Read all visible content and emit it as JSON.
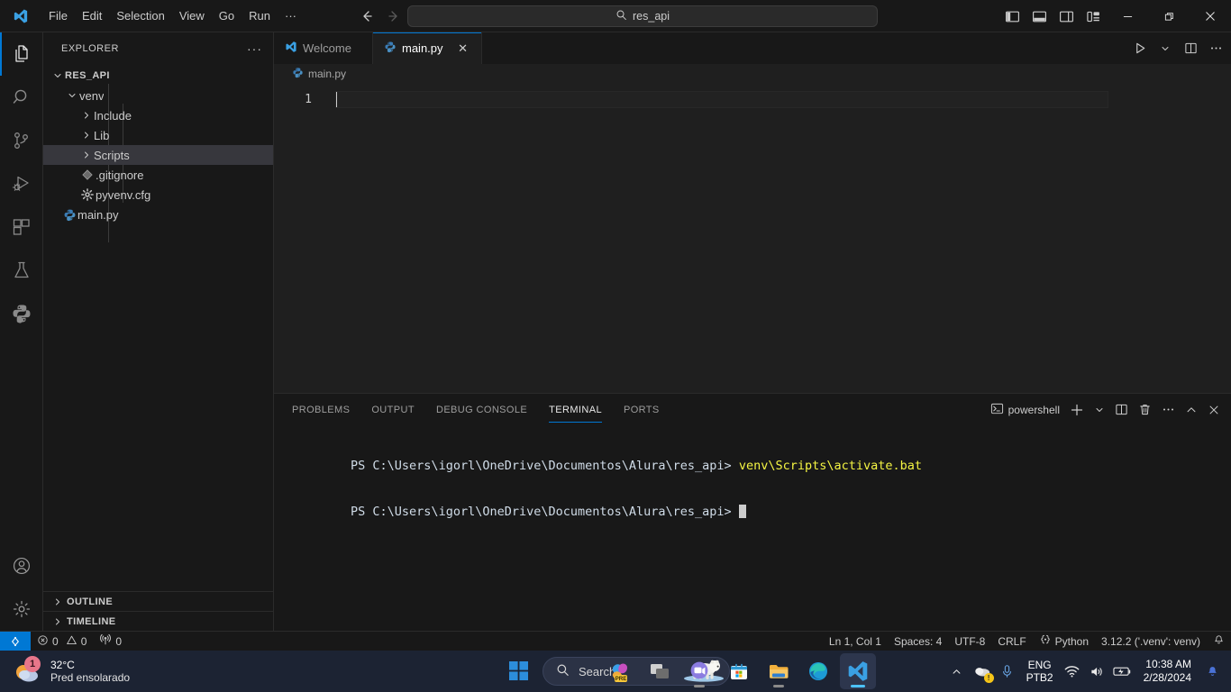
{
  "titlebar": {
    "menu": [
      "File",
      "Edit",
      "Selection",
      "View",
      "Go",
      "Run",
      "···"
    ],
    "command_center_value": "res_api",
    "back_icon": "arrow-left-icon",
    "forward_icon": "arrow-right-icon",
    "layout_icons": [
      "toggle-primary-sidebar-icon",
      "toggle-panel-icon",
      "toggle-secondary-sidebar-icon",
      "customize-layout-icon"
    ],
    "window_controls": [
      "minimize",
      "restore",
      "close"
    ]
  },
  "activitybar": {
    "items": [
      {
        "name": "explorer",
        "icon": "files-icon",
        "active": true
      },
      {
        "name": "search",
        "icon": "search-icon",
        "active": false
      },
      {
        "name": "source-control",
        "icon": "source-control-icon",
        "active": false
      },
      {
        "name": "run-and-debug",
        "icon": "run-debug-icon",
        "active": false
      },
      {
        "name": "extensions",
        "icon": "extensions-icon",
        "active": false
      },
      {
        "name": "testing",
        "icon": "beaker-icon",
        "active": false
      },
      {
        "name": "python",
        "icon": "python-icon",
        "active": false
      }
    ],
    "bottom": [
      {
        "name": "accounts",
        "icon": "account-icon"
      },
      {
        "name": "manage",
        "icon": "gear-icon"
      }
    ]
  },
  "sidebar": {
    "title": "EXPLORER",
    "more_actions": "···",
    "tree": [
      {
        "label": "RES_API",
        "type": "root",
        "depth": 0,
        "expanded": true,
        "selected": false,
        "icon": ""
      },
      {
        "label": "venv",
        "type": "folder",
        "depth": 1,
        "expanded": true,
        "selected": false,
        "icon": ""
      },
      {
        "label": "Include",
        "type": "folder",
        "depth": 2,
        "expanded": false,
        "selected": false,
        "icon": ""
      },
      {
        "label": "Lib",
        "type": "folder",
        "depth": 2,
        "expanded": false,
        "selected": false,
        "icon": ""
      },
      {
        "label": "Scripts",
        "type": "folder",
        "depth": 2,
        "expanded": false,
        "selected": true,
        "icon": ""
      },
      {
        "label": ".gitignore",
        "type": "file",
        "depth": 2,
        "expanded": false,
        "selected": false,
        "icon": "gitignore-icon"
      },
      {
        "label": "pyvenv.cfg",
        "type": "file",
        "depth": 2,
        "expanded": false,
        "selected": false,
        "icon": "config-gear-icon"
      },
      {
        "label": "main.py",
        "type": "file",
        "depth": 1,
        "expanded": false,
        "selected": false,
        "icon": "python-file-icon"
      }
    ],
    "sections": [
      "OUTLINE",
      "TIMELINE"
    ]
  },
  "editor": {
    "tabs": [
      {
        "label": "Welcome",
        "icon": "vscode-icon",
        "active": false,
        "closable": false
      },
      {
        "label": "main.py",
        "icon": "python-file-icon",
        "active": true,
        "closable": true,
        "close_glyph": "✕"
      }
    ],
    "actions": [
      "run-python-file-icon",
      "chevron-down-icon",
      "split-editor-icon",
      "more-actions-icon"
    ],
    "breadcrumb": "main.py",
    "breadcrumb_icon": "python-file-icon",
    "line_numbers": [
      "1"
    ],
    "content": ""
  },
  "panel": {
    "tabs": [
      "PROBLEMS",
      "OUTPUT",
      "DEBUG CONSOLE",
      "TERMINAL",
      "PORTS"
    ],
    "active_tab": "TERMINAL",
    "shell_label": "powershell",
    "shell_icon": "terminal-powershell-icon",
    "actions": [
      "new-terminal-icon",
      "chevron-down-icon",
      "split-terminal-icon",
      "kill-terminal-icon",
      "more-actions-icon",
      "maximize-panel-icon",
      "close-panel-icon"
    ],
    "terminal_lines": [
      {
        "prompt": "PS C:\\Users\\igorl\\OneDrive\\Documentos\\Alura\\res_api>",
        "command": "venv\\Scripts\\activate.bat",
        "caret": false
      },
      {
        "prompt": "PS C:\\Users\\igorl\\OneDrive\\Documentos\\Alura\\res_api>",
        "command": "",
        "caret": true
      }
    ]
  },
  "statusbar": {
    "remote_icon": "remote-window-icon",
    "errors_icon": "error-icon",
    "errors": "0",
    "warnings_icon": "warning-icon",
    "warnings": "0",
    "ports_icon": "radio-tower-icon",
    "ports": "0",
    "cursor_position": "Ln 1, Col 1",
    "indentation": "Spaces: 4",
    "encoding": "UTF-8",
    "eol": "CRLF",
    "language_icon": "python-brackets-icon",
    "language": "Python",
    "interpreter": "3.12.2 ('.venv': venv)",
    "bell_icon": "bell-icon"
  },
  "taskbar": {
    "weather": {
      "temperature": "32°C",
      "condition": "Pred ensolarado",
      "badge": "1",
      "icon": "sun-cloud-icon"
    },
    "start_icon": "windows-start-icon",
    "search": {
      "placeholder": "Search",
      "icon": "search-icon",
      "illustration": "polar-bear-icon"
    },
    "apps": [
      {
        "name": "copilot",
        "icon": "copilot-icon",
        "badge": "PRE",
        "active": false,
        "running": false
      },
      {
        "name": "task-view",
        "icon": "task-view-icon",
        "active": false,
        "running": false
      },
      {
        "name": "chat-teams",
        "icon": "teams-chat-icon",
        "active": false,
        "running": true
      },
      {
        "name": "microsoft-store",
        "icon": "store-icon",
        "active": false,
        "running": false
      },
      {
        "name": "file-explorer",
        "icon": "folder-icon",
        "active": false,
        "running": true
      },
      {
        "name": "microsoft-edge",
        "icon": "edge-icon",
        "active": false,
        "running": false
      },
      {
        "name": "vs-code",
        "icon": "vscode-icon",
        "active": true,
        "running": true
      }
    ],
    "tray": {
      "overflow_icon": "chevron-up-icon",
      "onedrive_icon": "onedrive-warning-icon",
      "microphone_icon": "microphone-icon",
      "language_line1": "ENG",
      "language_line2": "PTB2",
      "wifi_icon": "wifi-icon",
      "volume_icon": "speaker-icon",
      "battery_icon": "battery-charging-icon",
      "time": "10:38 AM",
      "date": "2/28/2024",
      "notification_icon": "bell-icon"
    }
  },
  "colors": {
    "accent": "#0078d4",
    "terminal_command": "#f5f543",
    "selection": "#37373d",
    "background": "#1f1f1f"
  }
}
